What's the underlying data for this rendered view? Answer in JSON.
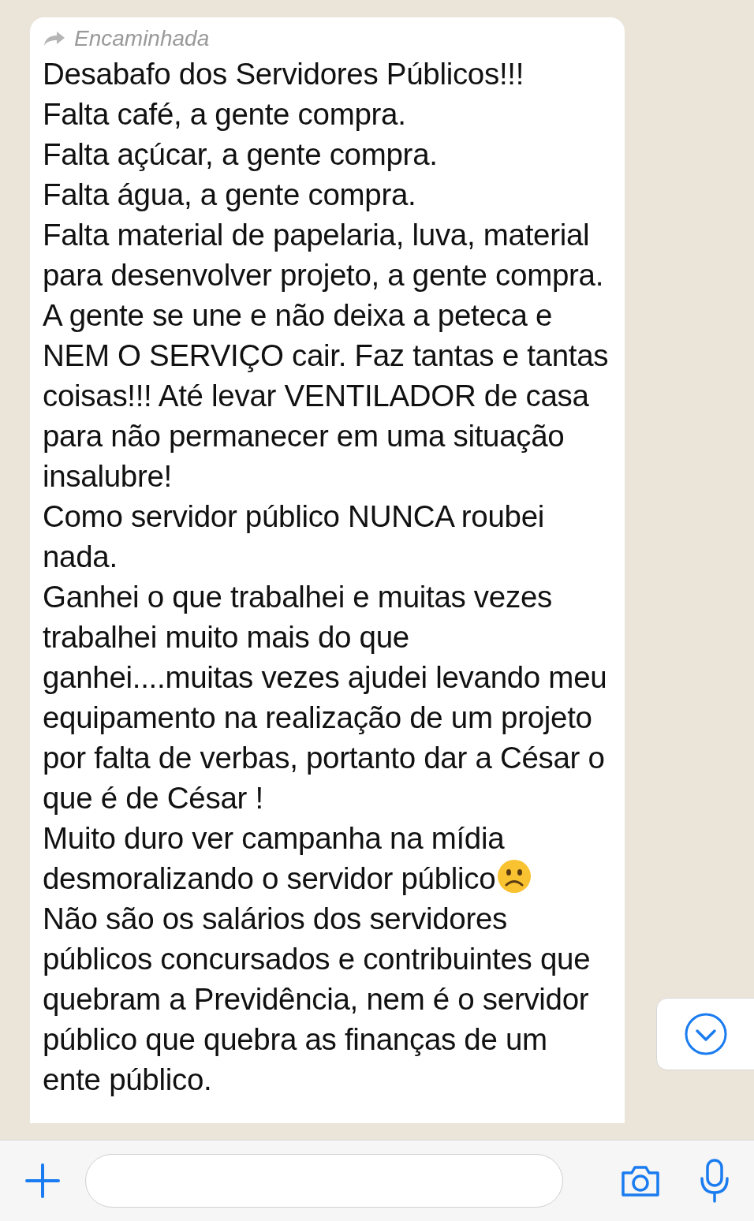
{
  "message": {
    "forwarded": true,
    "forward_label": "Encaminhada",
    "paragraphs": [
      {
        "text": "Desabafo dos Servidores Públicos!!!",
        "emoji": false
      },
      {
        "text": "Falta café, a gente compra.",
        "emoji": false
      },
      {
        "text": "Falta açúcar, a gente compra.",
        "emoji": false
      },
      {
        "text": "Falta água, a gente compra.",
        "emoji": false
      },
      {
        "text": "Falta material de papelaria, luva, material para desenvolver projeto, a gente compra.",
        "emoji": false
      },
      {
        "text": "A gente se une e não deixa a peteca e NEM O SERVIÇO cair. Faz tantas e tantas coisas!!! Até levar VENTILADOR de casa para não permanecer em uma situação insalubre!",
        "emoji": false
      },
      {
        "text": "Como servidor público NUNCA roubei nada.",
        "emoji": false
      },
      {
        "text": "Ganhei o que trabalhei e muitas vezes trabalhei muito mais do que ganhei....muitas vezes ajudei levando meu equipamento na realização de um projeto por falta de verbas, portanto dar a César o que é de César !",
        "emoji": false
      },
      {
        "text": "Muito duro ver campanha na mídia desmoralizando o servidor público",
        "emoji": true
      },
      {
        "text": "Não são os salários dos servidores públicos concursados e contribuintes que quebram a Previdência, nem é o servidor público que quebra as finanças de um ente público.",
        "emoji": false
      }
    ]
  }
}
